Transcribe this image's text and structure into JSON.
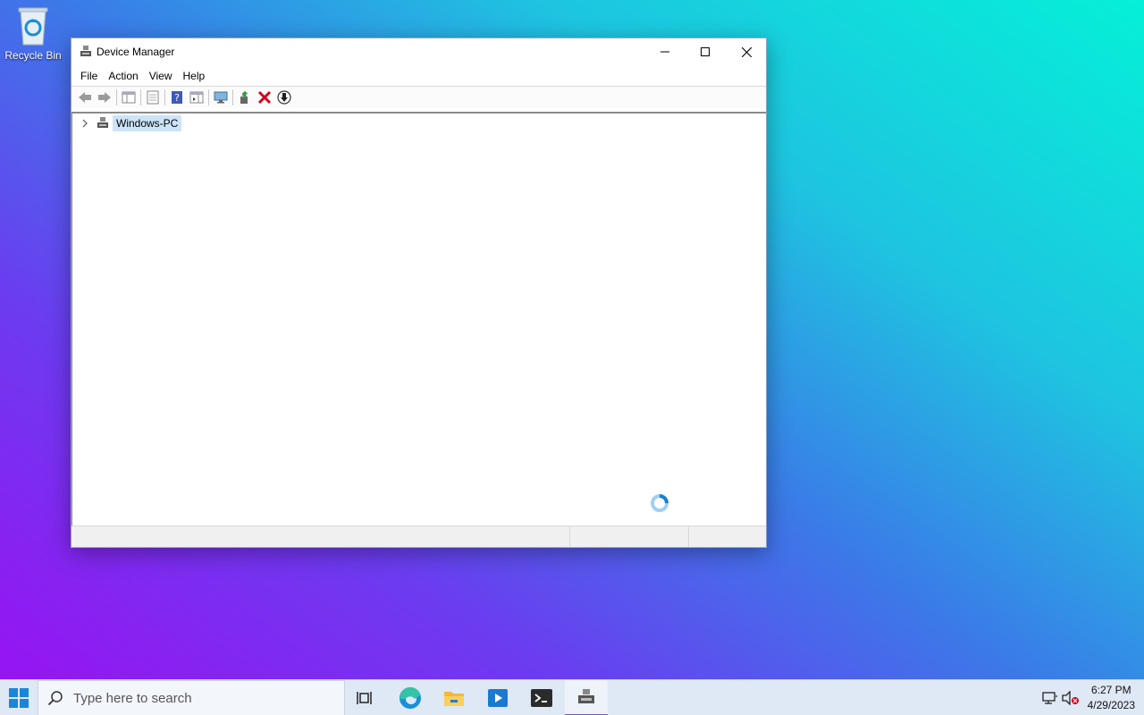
{
  "desktop": {
    "icons": [
      {
        "label": "Recycle Bin",
        "icon": "recycle-bin-icon"
      }
    ]
  },
  "window": {
    "title": "Device Manager",
    "controls": {
      "minimize": "minimize-icon",
      "maximize": "maximize-icon",
      "close": "close-icon"
    },
    "menu": [
      "File",
      "Action",
      "View",
      "Help"
    ],
    "toolbar": [
      "back-icon",
      "forward-icon",
      "show-hide-console-tree-icon",
      "properties-icon",
      "help-icon",
      "action-pane-icon",
      "monitor-icon",
      "update-driver-icon",
      "uninstall-device-icon",
      "disable-device-icon"
    ],
    "tree": {
      "root": {
        "label": "Windows-PC",
        "expanded": false,
        "selected": true
      }
    }
  },
  "taskbar": {
    "search": {
      "placeholder": "Type here to search"
    },
    "apps": [
      "task-view-icon",
      "edge-icon",
      "file-explorer-icon",
      "media-player-icon",
      "terminal-icon",
      "device-manager-icon"
    ],
    "active_app": "device-manager-icon",
    "tray": [
      "network-icon",
      "volume-muted-icon"
    ],
    "clock": {
      "time": "6:27 PM",
      "date": "4/29/2023"
    }
  },
  "colors": {
    "selection": "#cce4f7",
    "taskbar": "#dfe8f5",
    "accent": "#7a5cc8",
    "error_red": "#d0021b"
  }
}
